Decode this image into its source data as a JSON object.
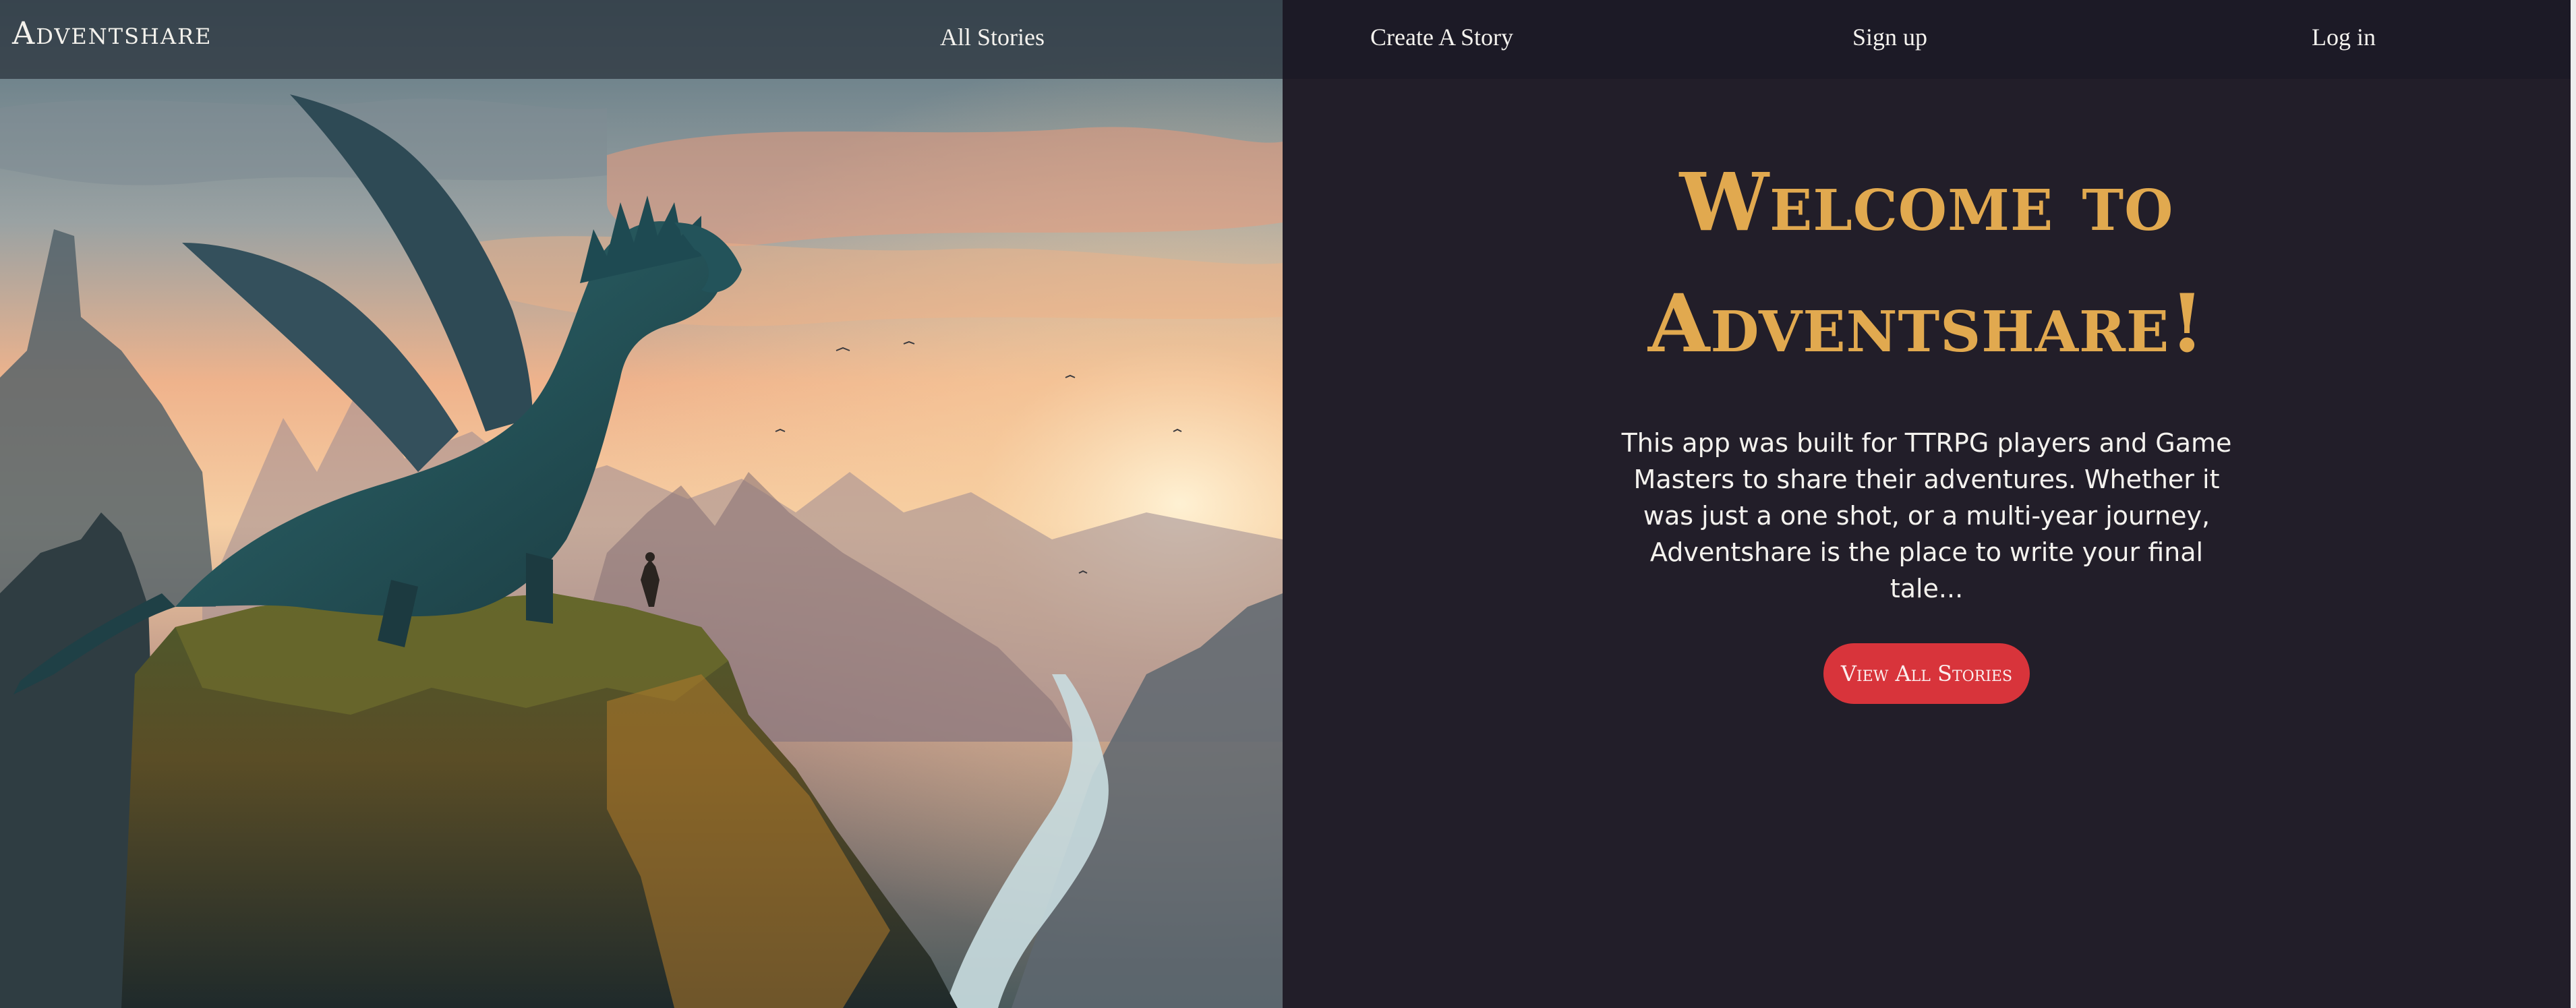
{
  "navbar": {
    "brand": "Adventshare",
    "links": {
      "all_stories": "All Stories",
      "create_story": "Create A Story",
      "sign_up": "Sign up",
      "log_in": "Log in"
    }
  },
  "hero": {
    "image_subject": "dragon-on-cliff-at-sunset"
  },
  "welcome": {
    "title": "Welcome to Adventshare!",
    "body": "This app was built for TTRPG players and Game Masters to share their adventures. Whether it was just a one shot, or a multi-year journey, Adventshare is the place to write your final tale...",
    "button_label": "View All Stories"
  },
  "colors": {
    "panel_background": "#221e29",
    "navbar_background": "#1c1a26",
    "title_gold": "#e1a94f",
    "button_red": "#d8343b",
    "text_light": "#f4f2ee"
  }
}
